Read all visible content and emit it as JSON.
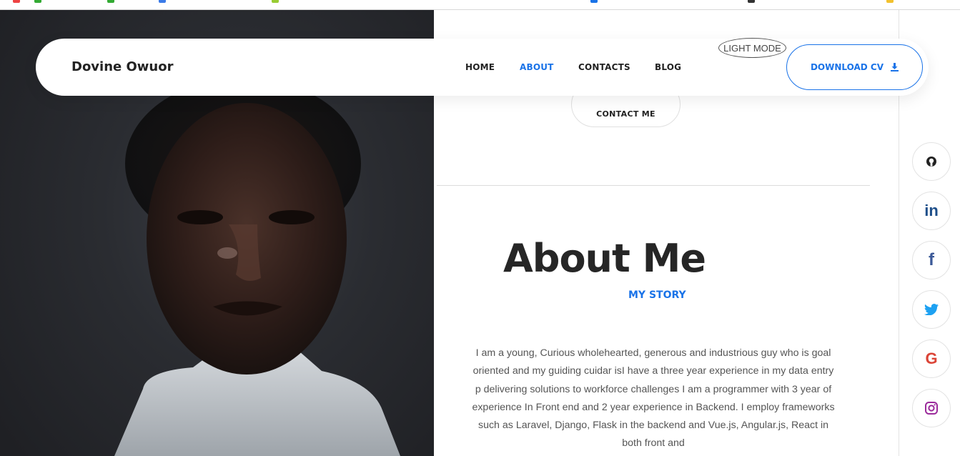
{
  "nav": {
    "brand": "Dovine Owuor",
    "items": [
      {
        "label": "HOME",
        "active": false
      },
      {
        "label": "ABOUT",
        "active": true
      },
      {
        "label": "CONTACTS",
        "active": false
      },
      {
        "label": "BLOG",
        "active": false
      }
    ],
    "mode_toggle": "LIGHT MODE",
    "download_label": "DOWNLOAD CV",
    "download_icon": "download-icon"
  },
  "hero": {
    "contact_button": "CONTACT ME"
  },
  "about": {
    "title": "About Me",
    "subtitle": "MY STORY",
    "story": "I am a young, Curious wholehearted, generous and industrious guy who is goal oriented and my guiding cuidar isI have a three year experience in my data entry p delivering solutions to workforce challenges I am a programmer with 3 year of experience In Front end and 2 year experience in Backend. I employ frameworks such as Laravel, Django, Flask in the backend and Vue.js, Angular.js, React in both front and"
  },
  "social": [
    {
      "name": "github-icon",
      "glyph": "",
      "color": "#222222"
    },
    {
      "name": "linkedin-icon",
      "glyph": "in",
      "color": "#1d4e89"
    },
    {
      "name": "facebook-icon",
      "glyph": "f",
      "color": "#3b5998"
    },
    {
      "name": "twitter-icon",
      "glyph": "",
      "color": "#1da1f2"
    },
    {
      "name": "google-icon",
      "glyph": "G",
      "color": "#db4437"
    },
    {
      "name": "instagram-icon",
      "glyph": "",
      "color": "#9b2b9b"
    }
  ],
  "colors": {
    "accent": "#1a73e8",
    "text": "#222222"
  }
}
